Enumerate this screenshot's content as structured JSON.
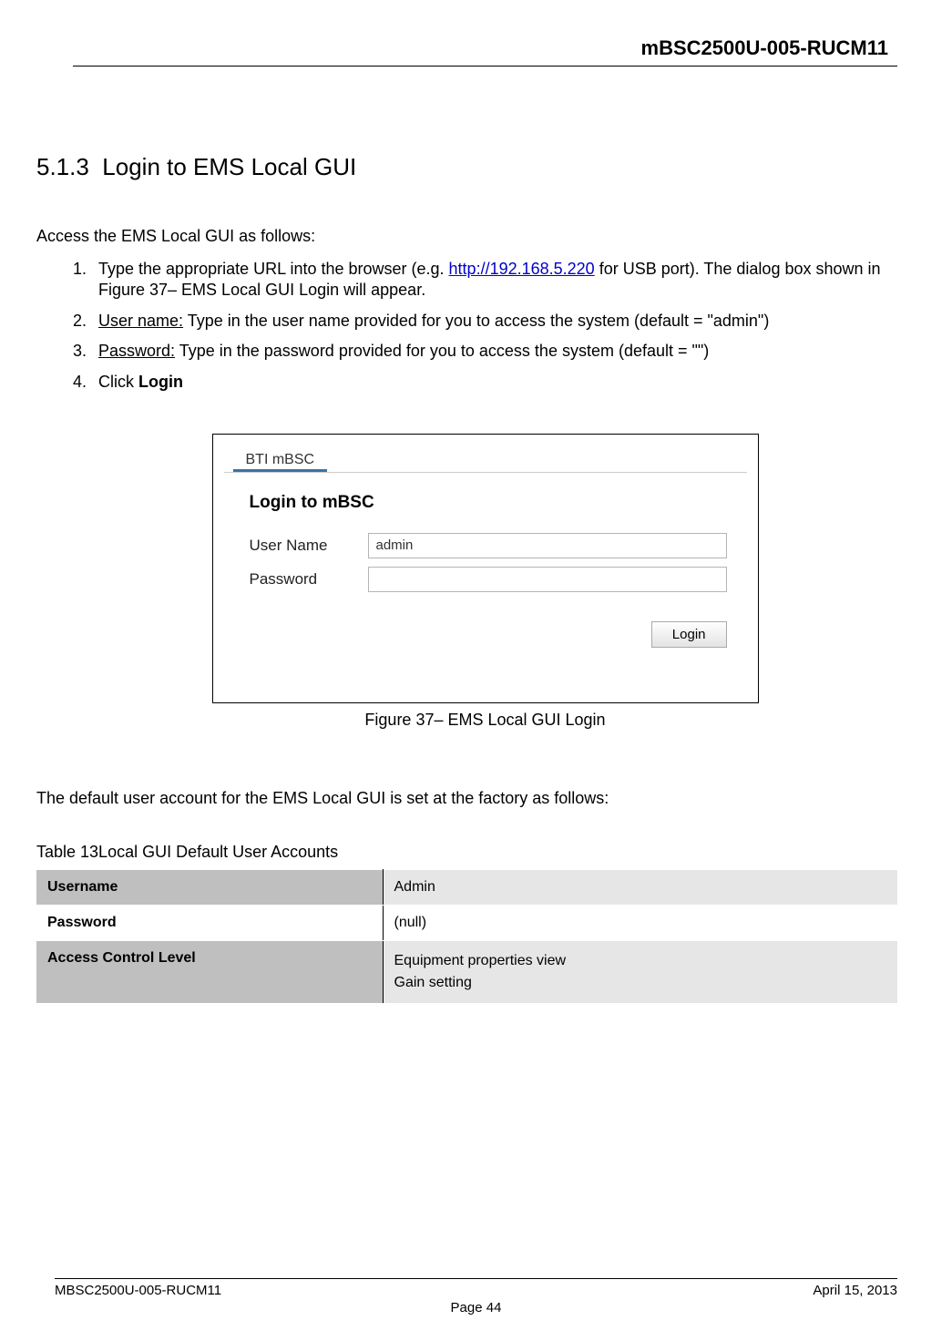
{
  "header": {
    "title": "mBSC2500U-005-RUCM11"
  },
  "section": {
    "number": "5.1.3",
    "title": "Login to EMS Local GUI",
    "intro": "Access the EMS Local GUI as follows:",
    "items": {
      "item1_pre": "Type the appropriate URL into the browser (e.g. ",
      "item1_link": "http://192.168.5.220",
      "item1_post": " for USB port). The dialog box shown in Figure 37– EMS Local GUI Login will appear.",
      "item2_label": "User name:",
      "item2_text": " Type in the user name provided for you to access the system (default = \"admin\")",
      "item3_label": "Password:",
      "item3_text": " Type in the password provided for you to access the system (default = \"\")",
      "item4_pre": "Click ",
      "item4_bold": "Login"
    }
  },
  "login_box": {
    "tab_label": "BTI mBSC",
    "form_title": "Login to mBSC",
    "username_label": "User Name",
    "username_value": "admin",
    "password_label": "Password",
    "password_value": "",
    "button_label": "Login"
  },
  "figure_caption": "Figure 37– EMS Local GUI Login",
  "default_account_text": "The default user account for the EMS Local GUI is set at the factory as follows:",
  "table": {
    "caption": "Table 13Local GUI Default User Accounts",
    "rows": {
      "username_label": "Username",
      "username_value": "Admin",
      "password_label": "Password",
      "password_value": "(null)",
      "acl_label": "Access Control Level",
      "acl_value1": "Equipment properties view",
      "acl_value2": "Gain setting"
    }
  },
  "footer": {
    "left": "MBSC2500U-005-RUCM11",
    "right": "April 15, 2013",
    "page": "Page 44"
  }
}
